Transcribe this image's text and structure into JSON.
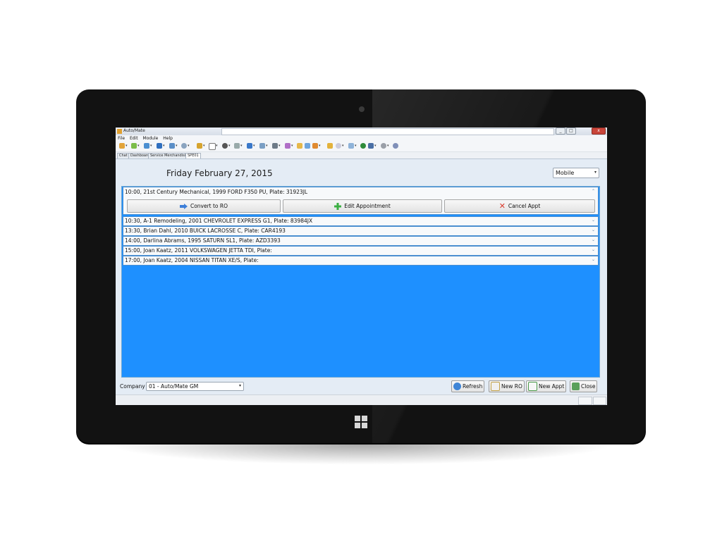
{
  "window": {
    "title": "Auto/Mate",
    "menu": [
      "File",
      "Edit",
      "Module",
      "Help"
    ],
    "controls": {
      "minimize": "_",
      "maximize": "□",
      "close": "x"
    }
  },
  "tabs": [
    {
      "label": "Chat",
      "active": false
    },
    {
      "label": "Dashboard",
      "active": false
    },
    {
      "label": "Service Merchandising",
      "active": false
    },
    {
      "label": "SPE01",
      "active": true
    }
  ],
  "header": {
    "date": "Friday February 27, 2015",
    "view_select": "Mobile"
  },
  "appointments": [
    {
      "text": "10:00, 21st Century Mechanical, 1999 FORD F350 PU, Plate: 31923JL",
      "expanded": true
    },
    {
      "text": "10:30, A-1 Remodeling, 2001 CHEVROLET EXPRESS G1, Plate: 83984JX",
      "expanded": false
    },
    {
      "text": "13:30, Brian Dahl, 2010 BUICK LACROSSE C, Plate: CAR4193",
      "expanded": false
    },
    {
      "text": "14:00, Darlina Abrams, 1995 SATURN SL1, Plate: AZD3393",
      "expanded": false
    },
    {
      "text": "15:00, Joan Kaatz, 2011 VOLKSWAGEN JETTA TDI, Plate:",
      "expanded": false
    },
    {
      "text": "17:00, Joan Kaatz, 2004 NISSAN TITAN XE/S, Plate:",
      "expanded": false
    }
  ],
  "actions": {
    "convert": "Convert to RO",
    "edit": "Edit Appointment",
    "cancel": "Cancel Appt"
  },
  "footer": {
    "company_label": "Company",
    "company_value": "01 - Auto/Mate GM",
    "refresh": "Refresh",
    "new_ro": "New RO",
    "new_appt": "New Appt",
    "close": "Close"
  },
  "colors": {
    "list_background": "#1e90ff",
    "panel_background": "#e4ecf5",
    "row_border": "#4b8fd0",
    "cancel_icon": "#d93a2b",
    "plus_icon": "#3cb043",
    "arrow_icon": "#3d7fd9"
  }
}
